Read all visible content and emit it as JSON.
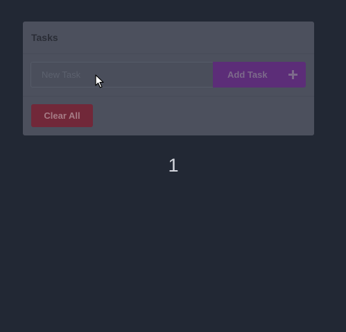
{
  "card": {
    "title": "Tasks",
    "input": {
      "placeholder": "New Task",
      "value": ""
    },
    "add_button": {
      "label": "Add Task",
      "icon": "plus-icon"
    },
    "clear_button": {
      "label": "Clear All"
    }
  },
  "counter": {
    "value": "1"
  },
  "colors": {
    "background": "#222834",
    "card": "#4c505d",
    "add_button": "#5c2d78",
    "clear_button": "#712839"
  }
}
